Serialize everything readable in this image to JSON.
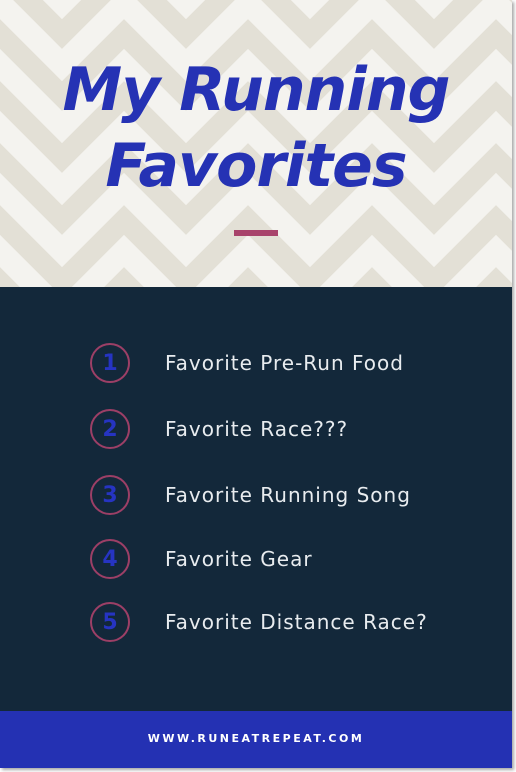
{
  "colors": {
    "header_background": "#f4f3ef",
    "chevron": "#e3e0d6",
    "title": "#2532b4",
    "accent": "#a8436b",
    "panel_background": "#13283a",
    "list_text": "#e8ecef",
    "number": "#2634c2",
    "footer_background": "#2431b3"
  },
  "header": {
    "title_line1": "My Running",
    "title_line2": "Favorites",
    "background_pattern": "chevron-zigzag"
  },
  "list": {
    "items": [
      {
        "number": "1",
        "label": "Favorite Pre-Run Food"
      },
      {
        "number": "2",
        "label": "Favorite Race???"
      },
      {
        "number": "3",
        "label": "Favorite Running Song"
      },
      {
        "number": "4",
        "label": "Favorite Gear"
      },
      {
        "number": "5",
        "label": "Favorite Distance Race?"
      }
    ]
  },
  "footer": {
    "url": "WWW.RUNEATREPEAT.COM"
  }
}
